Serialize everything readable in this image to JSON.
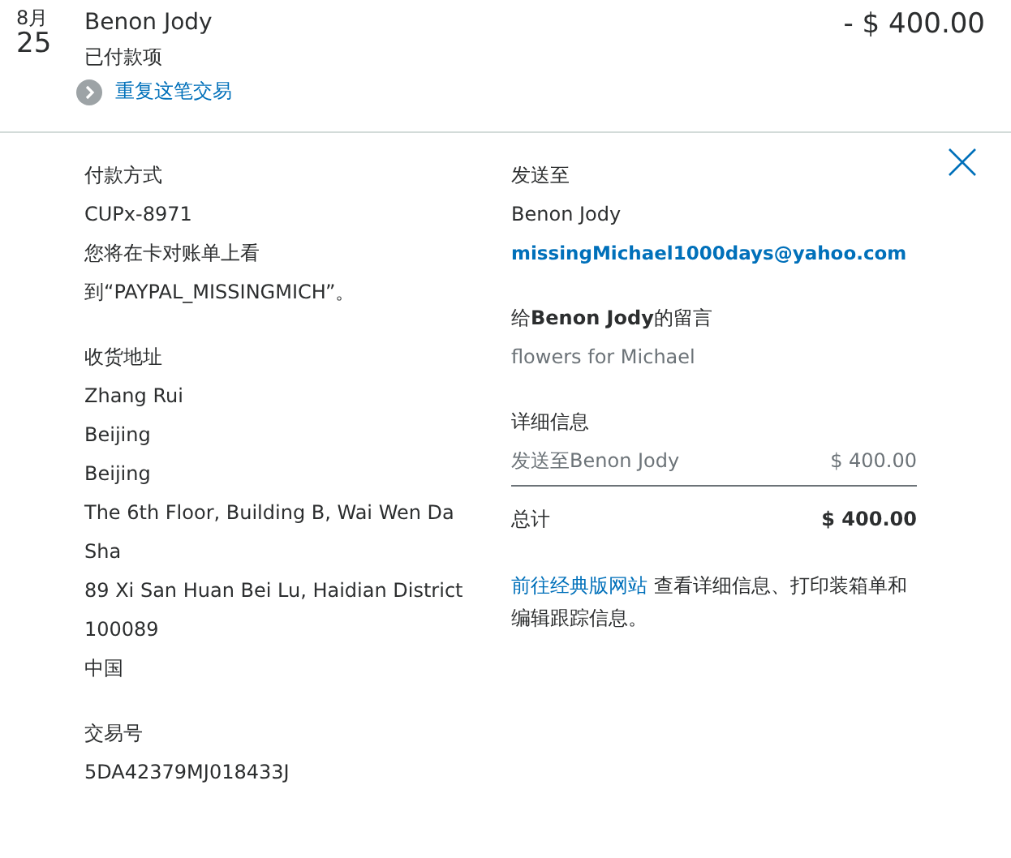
{
  "transaction": {
    "month": "8月",
    "day": "25",
    "name": "Benon Jody",
    "status": "已付款项",
    "repeat_link": "重复这笔交易",
    "amount": "- $ 400.00"
  },
  "left": [
    {
      "heading": "付款方式",
      "lines": [
        "CUPx-8971",
        "您将在卡对账单上看",
        "到“PAYPAL_MISSINGMICH”。"
      ]
    },
    {
      "heading": "收货地址",
      "lines": [
        "Zhang Rui",
        "Beijing",
        "Beijing",
        "The 6th Floor, Building B, Wai Wen Da",
        "Sha",
        "89 Xi San Huan Bei Lu, Haidian District",
        "100089",
        "中国"
      ]
    },
    {
      "heading": "交易号",
      "lines": [
        "5DA42379MJ018433J"
      ]
    }
  ],
  "sent_to": {
    "heading": "发送至",
    "name": "Benon Jody",
    "email": "missingMichael1000days@yahoo.com"
  },
  "message": {
    "heading": "给**Benon Jody**的留言",
    "text": "flowers for Michael"
  },
  "details": {
    "heading": "详细信息",
    "item_label": "发送至Benon Jody",
    "item_amount": "$ 400.00",
    "total_label": "总计",
    "total_amount": "$ 400.00"
  },
  "footer": {
    "link": "前往经典版网站",
    "text": " 查看详细信息、打印装箱单和编辑跟踪信息。"
  }
}
